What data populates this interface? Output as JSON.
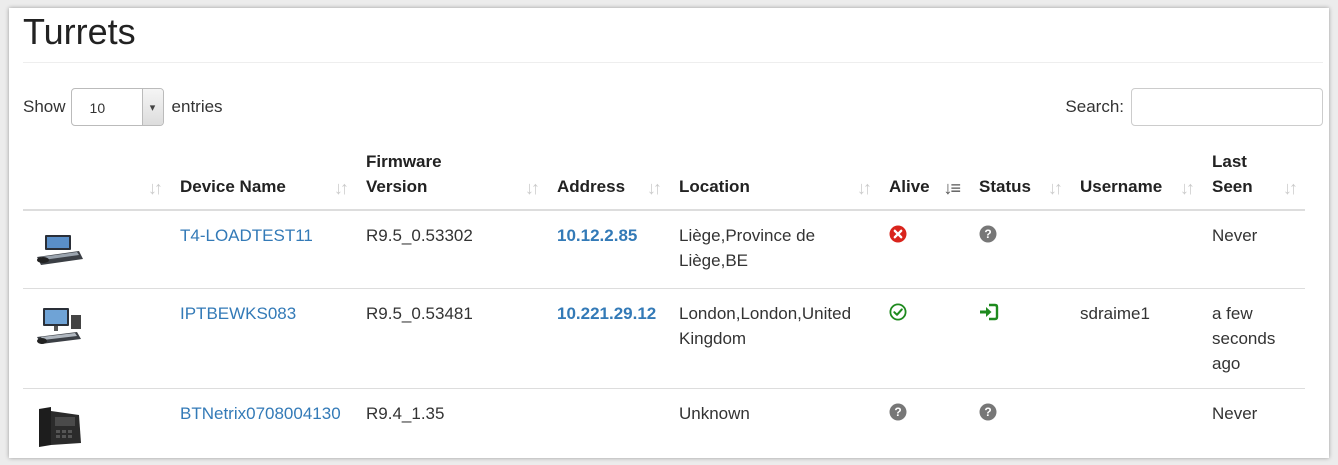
{
  "page": {
    "title": "Turrets"
  },
  "length_control": {
    "show_label": "Show",
    "value": "10",
    "entries_label": "entries"
  },
  "search": {
    "label": "Search:",
    "value": "",
    "placeholder": ""
  },
  "columns": [
    "",
    "Device Name",
    "Firmware Version",
    "Address",
    "Location",
    "Alive",
    "Status",
    "Username",
    "Last Seen"
  ],
  "rows": [
    {
      "device_icon": "desk-turret-icon",
      "device_name": "T4-LOADTEST11",
      "firmware": "R9.5_0.53302",
      "address": "10.12.2.85",
      "location": "Liège,Province de Liège,BE",
      "alive_icon": "times-circle-icon",
      "status_icon": "question-circle-icon",
      "username": "",
      "last_seen": "Never"
    },
    {
      "device_icon": "workstation-turret-icon",
      "device_name": "IPTBEWKS083",
      "firmware": "R9.5_0.53481",
      "address": "10.221.29.12",
      "location": "London,London,United Kingdom",
      "alive_icon": "check-circle-icon",
      "status_icon": "sign-in-icon",
      "username": "sdraime1",
      "last_seen": "a few seconds ago"
    },
    {
      "device_icon": "desk-phone-icon",
      "device_name": "BTNetrix0708004130",
      "firmware": "R9.4_1.35",
      "address": "",
      "location": "Unknown",
      "alive_icon": "question-circle-icon",
      "status_icon": "question-circle-icon",
      "username": "",
      "last_seen": "Never"
    }
  ],
  "colors": {
    "link": "#337ab7",
    "alive_down": "#d9241c",
    "alive_up": "#1e8a1e",
    "login": "#1e8a1e",
    "unknown": "#777777"
  }
}
